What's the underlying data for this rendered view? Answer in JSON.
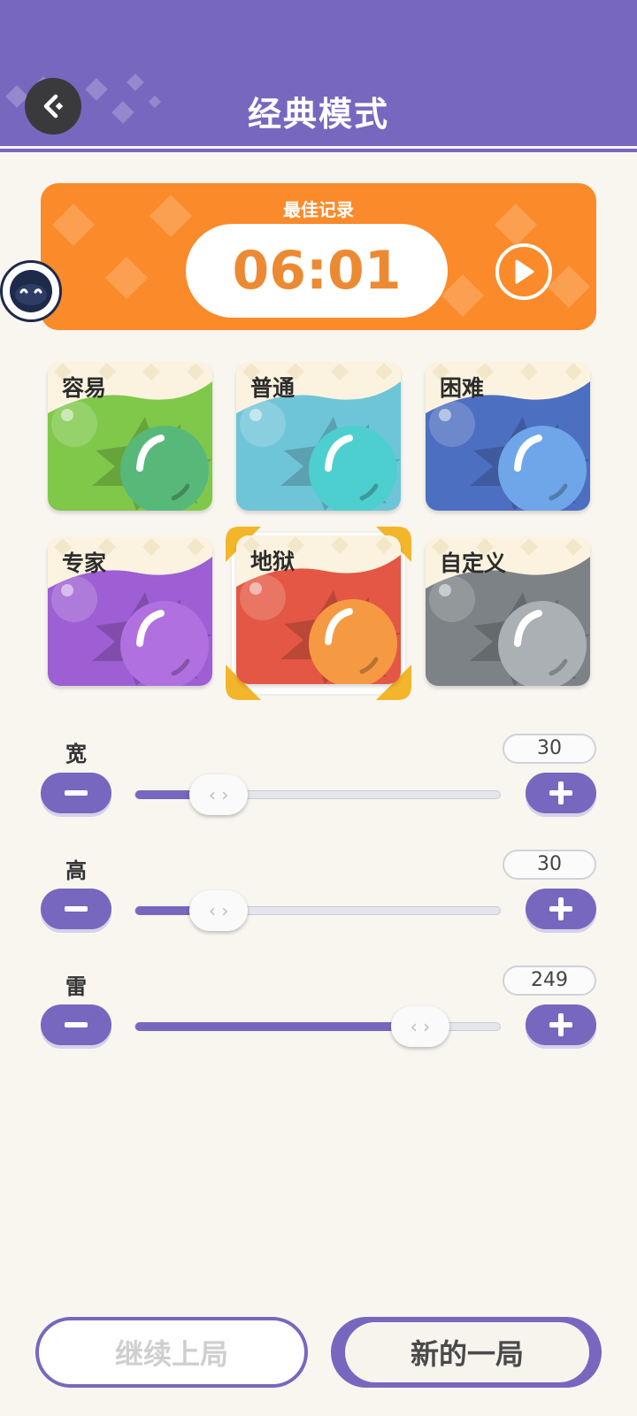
{
  "header": {
    "title": "经典模式",
    "back_icon": "back-arrow-icon"
  },
  "record": {
    "label": "最佳记录",
    "time": "06:01"
  },
  "difficulties": [
    {
      "label": "容易",
      "color": "#7fc84a",
      "ball": "#58b87a"
    },
    {
      "label": "普通",
      "color": "#6fc5d8",
      "ball": "#4ecfcf"
    },
    {
      "label": "困难",
      "color": "#4d6fc1",
      "ball": "#6fa6ea"
    },
    {
      "label": "专家",
      "color": "#9d5fd3",
      "ball": "#b070e0"
    },
    {
      "label": "地狱",
      "color": "#e45744",
      "ball": "#f59a43",
      "selected": true
    },
    {
      "label": "自定义",
      "color": "#7c8285",
      "ball": "#aab0b3"
    }
  ],
  "sliders": {
    "width": {
      "label": "宽",
      "value": "30",
      "fill": 0.23
    },
    "height": {
      "label": "高",
      "value": "30",
      "fill": 0.23
    },
    "mines": {
      "label": "雷",
      "value": "249",
      "fill": 0.78
    }
  },
  "buttons": {
    "continue": "继续上局",
    "new_game": "新的一局"
  },
  "colors": {
    "accent": "#7867bf",
    "record": "#fb8a2a",
    "background": "#f9f6f0"
  }
}
